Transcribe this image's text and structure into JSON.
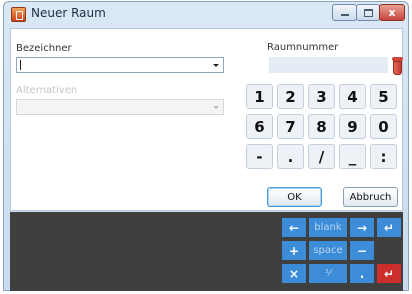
{
  "window": {
    "title": "Neuer Raum",
    "controls": {
      "minimize": "",
      "maximize": "",
      "close": "x"
    }
  },
  "form": {
    "bezeichner_label": "Bezeichner",
    "bezeichner_value": "",
    "alternativen_label": "Alternativen",
    "alternativen_value": "",
    "raumnummer_label": "Raumnummer",
    "raumnummer_value": ""
  },
  "keypad": {
    "row1": [
      "1",
      "2",
      "3",
      "4",
      "5"
    ],
    "row2": [
      "6",
      "7",
      "8",
      "9",
      "0"
    ],
    "row3": [
      "-",
      ".",
      "/",
      "_",
      ":"
    ]
  },
  "buttons": {
    "ok": "OK",
    "cancel": "Abbruch"
  },
  "virtual_keyboard": {
    "row1": [
      "←",
      "blank",
      "→",
      "↵"
    ],
    "row2": [
      "+",
      "space",
      "−"
    ],
    "row3": [
      "×",
      "⅟",
      ".",
      "↵"
    ]
  },
  "colors": {
    "keyboard_blue": "#3d8cd8",
    "keyboard_red": "#cc2d2d",
    "panel_dark": "#3f3f3f"
  },
  "icons": {
    "app": "app-icon",
    "trash": "trash-icon"
  }
}
